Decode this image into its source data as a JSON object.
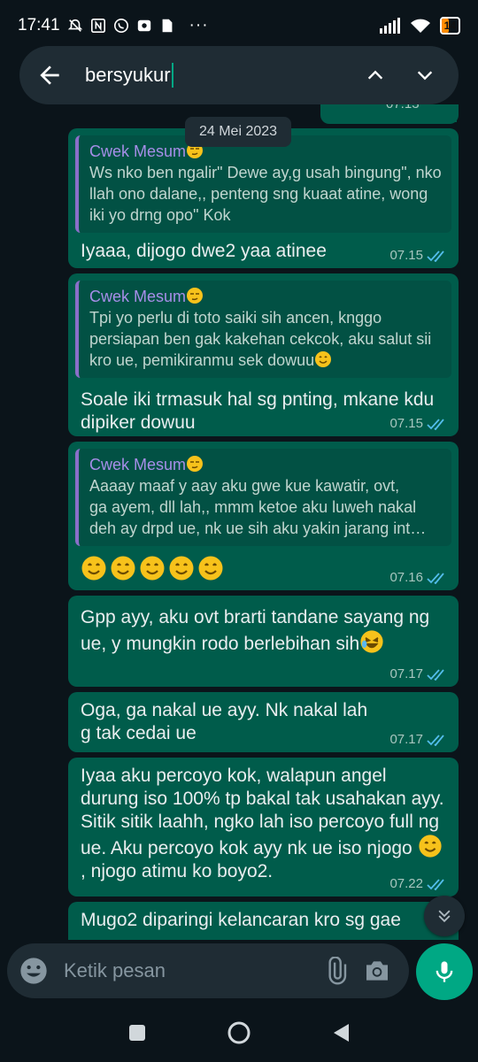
{
  "status_bar": {
    "time": "17:41",
    "battery": "14",
    "more": "···"
  },
  "search": {
    "query": "bersyukur"
  },
  "date_chip": "24 Mei 2023",
  "peek_time": "07.13",
  "messages": [
    {
      "quote": {
        "name": "Cwek Mesum",
        "text": "Ws nko ben ngalir\" Dewe ay,g usah bingung\", nko llah ono dalane,, penteng sng kuaat atine, wong iki yo drng opo\" Kok"
      },
      "text": "Iyaaa, dijogo dwe2 yaa atinee",
      "time": "07.15"
    },
    {
      "quote": {
        "name": "Cwek Mesum",
        "text": "Tpi yo perlu di toto saiki sih ancen, knggo persiapan ben gak kakehan cekcok, aku salut sii kro ue, pemikiranmu sek dowuu"
      },
      "text": "Soale iki trmasuk hal sg pnting, mkane kdu dipiker dowuu",
      "time": "07.15"
    },
    {
      "quote": {
        "name": "Cwek Mesum",
        "line1": "Aaaay maaf y aay aku gwe kue kawatir, ovt,",
        "line2": "ga ayem, dll lah,, mmm ketoe aku luweh nakal",
        "line3": "deh ay drpd ue, nk ue sih aku yakin jarang int…"
      },
      "text": "",
      "time": "07.16"
    },
    {
      "text": "Gpp ayy, aku ovt brarti tandane sayang ng ue, y mungkin rodo berlebihan sih",
      "time": "07.17"
    },
    {
      "text": "Oga, ga nakal ue ayy. Nk nakal lah g tak cedai ue",
      "time": "07.17"
    },
    {
      "text_a": "Iyaa aku percoyo kok, walapun angel durung iso 100% tp bakal tak usahakan ayy. Sitik sitik laahh, ngko lah iso percoyo full ng ue. Aku percoyo kok ayy nk ue iso njogo ",
      "text_b": ", njogo atimu ko boyo2.",
      "time": "07.22"
    },
    {
      "text": "Mugo2 diparingi kelancaran kro sg gae"
    }
  ],
  "composer": {
    "placeholder": "Ketik pesan"
  },
  "colors": {
    "bubble": "#005c4b",
    "background": "#0b141a",
    "accent": "#00a884",
    "quote_name": "#a68ee8"
  }
}
